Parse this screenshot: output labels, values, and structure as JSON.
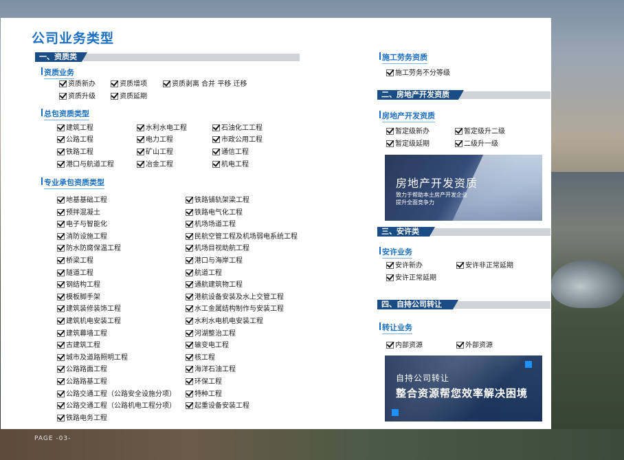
{
  "page_title": "公司业务类型",
  "page_number": "PAGE -03-",
  "left": {
    "section1_header": "一、资质类",
    "group1": {
      "title": "资质业务",
      "items": [
        "资质新办",
        "资质增项",
        "资质剥离 合并 平移 迁移",
        "资质升级",
        "资质延期"
      ]
    },
    "group2": {
      "title": "总包资质类型",
      "items": [
        "建筑工程",
        "水利水电工程",
        "石油化工工程",
        "公路工程",
        "电力工程",
        "市政公用工程",
        "铁路工程",
        "矿山工程",
        "通信工程",
        "港口与航道工程",
        "冶金工程",
        "机电工程"
      ]
    },
    "group3": {
      "title": "专业承包资质类型",
      "col1": [
        "地基基础工程",
        "预拌混凝土",
        "电子与智能化",
        "消防设施工程",
        "防水防腐保温工程",
        "桥梁工程",
        "隧道工程",
        "钢结构工程",
        "模板脚手架",
        "建筑装修装饰工程",
        "建筑机电安装工程",
        "建筑幕墙工程",
        "古建筑工程",
        "城市及道路照明工程",
        "公路路面工程",
        "公路路基工程",
        "公路交通工程（公路安全设施分项）",
        "公路交通工程（公路机电工程分项）",
        "铁路电务工程"
      ],
      "col2": [
        "铁路铺轨架梁工程",
        "铁路电气化工程",
        "机场场道工程",
        "民航空管工程及机场弱电系统工程",
        "机场目视助航工程",
        "港口与海岸工程",
        "航道工程",
        "通航建筑物工程",
        "港航设备安装及水上交管工程",
        "水工金属结构制作与安装工程",
        "水利水电机电安装工程",
        "河湖整治工程",
        "输变电工程",
        "核工程",
        "海洋石油工程",
        "环保工程",
        "特种工程",
        "起重设备安装工程"
      ]
    }
  },
  "right": {
    "labor": {
      "title": "施工劳务资质",
      "items": [
        "施工劳务不分等级"
      ]
    },
    "section2_header": "二、房地产开发资质",
    "realestate": {
      "title": "房地产开发资质",
      "items": [
        "暂定级新办",
        "暂定级升二级",
        "暂定级延期",
        "二级升一级"
      ]
    },
    "banner1": {
      "title": "房地产开发资质",
      "line1": "致力于帮助本土房产开发企业",
      "line2": "提升全面竞争力"
    },
    "section3_header": "三、安许类",
    "safety": {
      "title": "安许业务",
      "items": [
        "安许新办",
        "安许非正常延期",
        "安许正常延期"
      ]
    },
    "section4_header": "四、自持公司转让",
    "transfer": {
      "title": "转让业务",
      "items": [
        "内部资源",
        "外部资源"
      ]
    },
    "banner2": {
      "line1": "自持公司转让",
      "line2": "整合资源帮您效率解决困境"
    }
  },
  "colors": {
    "accent": "#1b6fc2",
    "header_bg": "#1a4d86",
    "header_grey": "#cfd3d7"
  },
  "icons": {
    "checkbox": "checked-box-icon"
  }
}
